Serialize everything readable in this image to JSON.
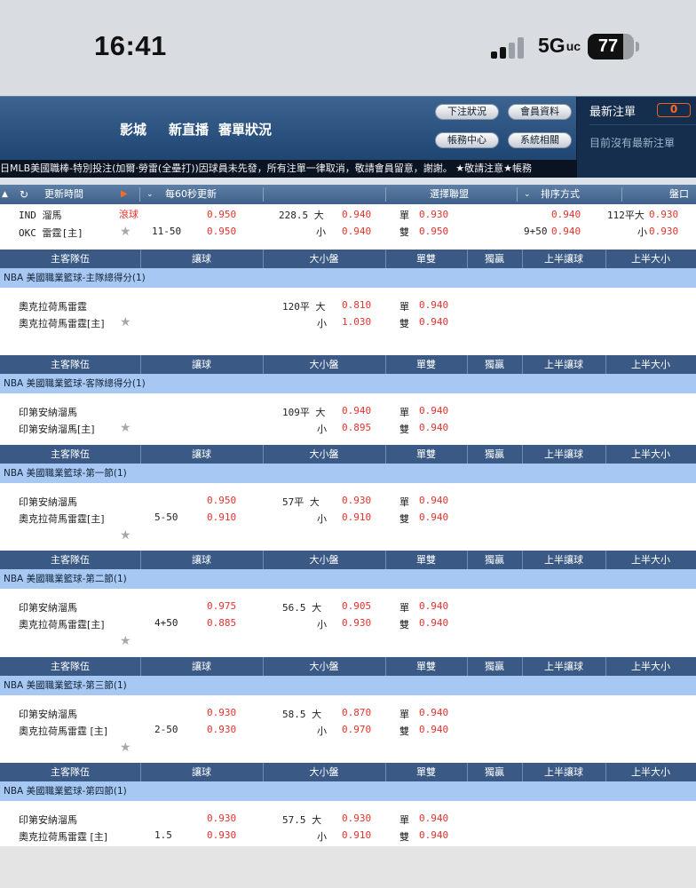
{
  "status": {
    "time": "16:41",
    "network": "5G",
    "network_sup": "uc",
    "battery": "77",
    "battery_level": 0.77
  },
  "header": {
    "nav": [
      "影城",
      "新直播",
      "審單狀況"
    ],
    "buttons": [
      "下注狀況",
      "會員資料",
      "帳務中心",
      "系統相關"
    ],
    "latest_title": "最新注單",
    "latest_count": "0",
    "latest_empty": "目前沒有最新注單"
  },
  "ticker": "日MLB美國職棒-特別投注(加爾·勞雷(全壘打))因球員未先發，所有注單一律取消，敬請會員留意，謝謝。 ★敬請注意★帳務",
  "filterbar": {
    "update_label": "更新時間",
    "interval": "每60秒更新",
    "league": "選擇聯盟",
    "sort": "排序方式",
    "market": "盤口"
  },
  "top_match": {
    "team1": "IND 溜馬",
    "team2": "OKC 雷霆[主]",
    "live": "滾球",
    "score": "11-50",
    "odds1": "0.950",
    "odds2": "0.950",
    "ou_line": "228.5 大",
    "ou_small": "小",
    "ou1": "0.940",
    "ou2": "0.940",
    "odd_label": "單",
    "even_label": "雙",
    "odd": "0.930",
    "even": "0.950",
    "h1_line": "9+50",
    "h1_odds1": "0.940",
    "h1_odds2": "0.940",
    "h1_ou_line": "112平大",
    "h1_ou_small": "小",
    "h1_ou1": "0.930",
    "h1_ou2": "0.930"
  },
  "columns": [
    "主客隊伍",
    "讓球",
    "大小盤",
    "單雙",
    "獨贏",
    "上半讓球",
    "上半大小"
  ],
  "sections": [
    {
      "league": "NBA 美國職業籃球-主隊總得分(1)",
      "team1": "奧克拉荷馬雷霆",
      "team2": "奧克拉荷馬雷霆[主]",
      "hcap": "",
      "hodds1": "",
      "hodds2": "",
      "ou_line": "120平 大",
      "ou_small": "小",
      "ou1": "0.810",
      "ou2": "1.030",
      "odd_label": "單",
      "even_label": "雙",
      "odd": "0.940",
      "even": "0.940"
    },
    {
      "league": "NBA 美國職業籃球-客隊總得分(1)",
      "team1": "印第安納溜馬",
      "team2": "印第安納溜馬[主]",
      "hcap": "",
      "hodds1": "",
      "hodds2": "",
      "ou_line": "109平 大",
      "ou_small": "小",
      "ou1": "0.940",
      "ou2": "0.895",
      "odd_label": "單",
      "even_label": "雙",
      "odd": "0.940",
      "even": "0.940"
    },
    {
      "league": "NBA 美國職業籃球-第一節(1)",
      "team1": "印第安納溜馬",
      "team2": "奧克拉荷馬雷霆[主]",
      "hcap": "5-50",
      "hodds1": "0.950",
      "hodds2": "0.910",
      "ou_line": "57平 大",
      "ou_small": "小",
      "ou1": "0.930",
      "ou2": "0.910",
      "odd_label": "單",
      "even_label": "雙",
      "odd": "0.940",
      "even": "0.940"
    },
    {
      "league": "NBA 美國職業籃球-第二節(1)",
      "team1": "印第安納溜馬",
      "team2": "奧克拉荷馬雷霆[主]",
      "hcap": "4+50",
      "hodds1": "0.975",
      "hodds2": "0.885",
      "ou_line": "56.5 大",
      "ou_small": "小",
      "ou1": "0.905",
      "ou2": "0.930",
      "odd_label": "單",
      "even_label": "雙",
      "odd": "0.940",
      "even": "0.940"
    },
    {
      "league": "NBA 美國職業籃球-第三節(1)",
      "team1": "印第安納溜馬",
      "team2": "奧克拉荷馬雷霆 [主]",
      "hcap": "2-50",
      "hodds1": "0.930",
      "hodds2": "0.930",
      "ou_line": "58.5 大",
      "ou_small": "小",
      "ou1": "0.870",
      "ou2": "0.970",
      "odd_label": "單",
      "even_label": "雙",
      "odd": "0.940",
      "even": "0.940"
    },
    {
      "league": "NBA 美國職業籃球-第四節(1)",
      "team1": "印第安納溜馬",
      "team2": "奧克拉荷馬雷霆 [主]",
      "hcap": "1.5",
      "hodds1": "0.930",
      "hodds2": "0.930",
      "ou_line": "57.5 大",
      "ou_small": "小",
      "ou1": "0.930",
      "ou2": "0.910",
      "odd_label": "單",
      "even_label": "雙",
      "odd": "0.940",
      "even": "0.940"
    }
  ]
}
